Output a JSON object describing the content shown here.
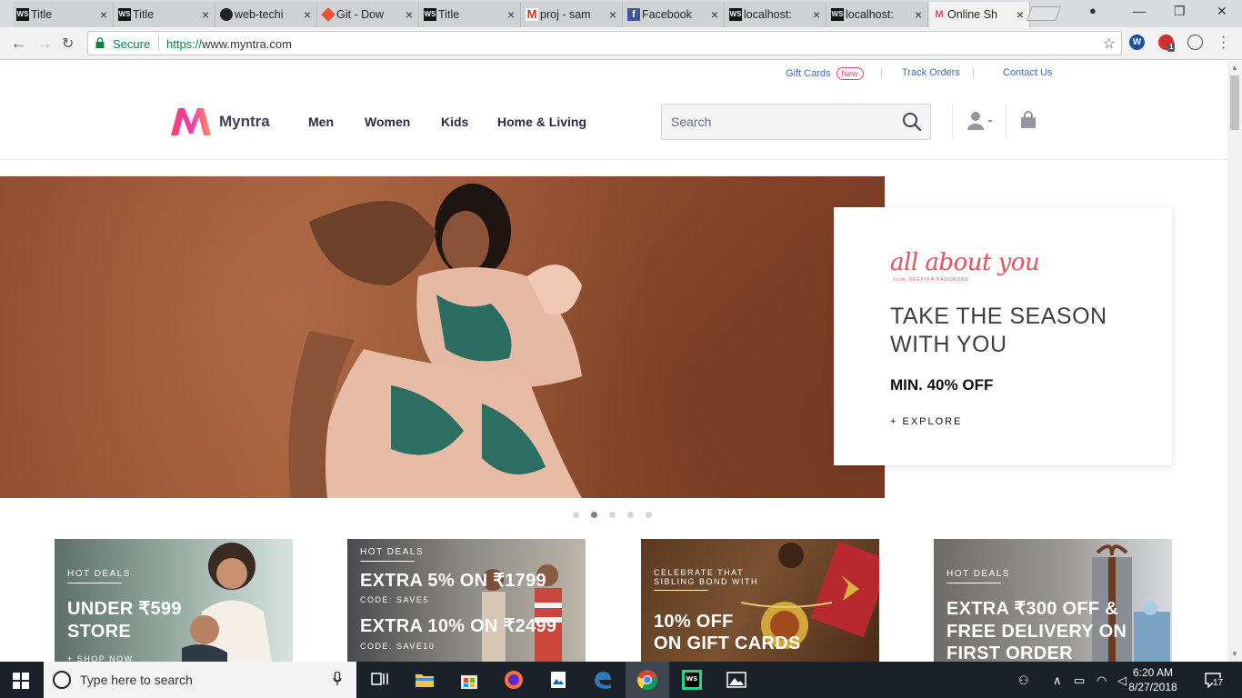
{
  "browser": {
    "tabs": [
      {
        "title": "Title",
        "favicon": "webstorm-icon",
        "active": false
      },
      {
        "title": "Title",
        "favicon": "webstorm-icon",
        "active": false
      },
      {
        "title": "web-techi",
        "favicon": "github-icon",
        "active": false
      },
      {
        "title": "Git - Dow",
        "favicon": "git-icon",
        "active": false
      },
      {
        "title": "Title",
        "favicon": "webstorm-icon",
        "active": false
      },
      {
        "title": "proj - sam",
        "favicon": "gmail-icon",
        "active": false
      },
      {
        "title": "Facebook",
        "favicon": "facebook-icon",
        "active": false
      },
      {
        "title": "localhost:",
        "favicon": "webstorm-icon",
        "active": false
      },
      {
        "title": "localhost:",
        "favicon": "webstorm-icon",
        "active": false
      },
      {
        "title": "Online Sh",
        "favicon": "myntra-icon",
        "active": true
      }
    ],
    "tab_close": "×",
    "secure_label": "Secure",
    "url_protocol": "https://",
    "url_host": "www.myntra.com",
    "extension_badge": "1"
  },
  "site": {
    "utility_links": {
      "gift_cards": "Gift Cards",
      "new_badge": "New",
      "track_orders": "Track Orders",
      "contact_us": "Contact Us"
    },
    "brand": "Myntra",
    "nav": [
      "Men",
      "Women",
      "Kids",
      "Home & Living"
    ],
    "search_placeholder": "Search",
    "accent_color": "#ff3f6c"
  },
  "hero": {
    "script_title": "all about you",
    "script_subtitle": "from DEEPIKA PADUKONE",
    "title_line1": "TAKE THE SEASON",
    "title_line2": "WITH YOU",
    "offer": "MIN. 40% OFF",
    "cta": "+ EXPLORE",
    "slide_count": 5,
    "active_slide": 2
  },
  "deals": [
    {
      "tag": "HOT DEALS",
      "line1": "UNDER ₹599",
      "line2": "STORE",
      "note": "+ SHOP NOW"
    },
    {
      "tag": "HOT DEALS",
      "line1": "EXTRA 5% ON ₹1799",
      "code1": "CODE: SAVE5",
      "line2": "EXTRA 10% ON ₹2499",
      "code2": "CODE: SAVE10"
    },
    {
      "tag": "CELEBRATE THAT",
      "tag2": "SIBLING BOND WITH",
      "line1": "10% OFF",
      "line2": "ON GIFT CARDS"
    },
    {
      "tag": "HOT DEALS",
      "line1": "EXTRA ₹300 OFF &",
      "line2": "FREE DELIVERY ON",
      "line3": "FIRST ORDER"
    }
  ],
  "taskbar": {
    "search_text": "Type here to search",
    "time": "6:20 AM",
    "date": "8/27/2018",
    "notification_count": "17"
  }
}
